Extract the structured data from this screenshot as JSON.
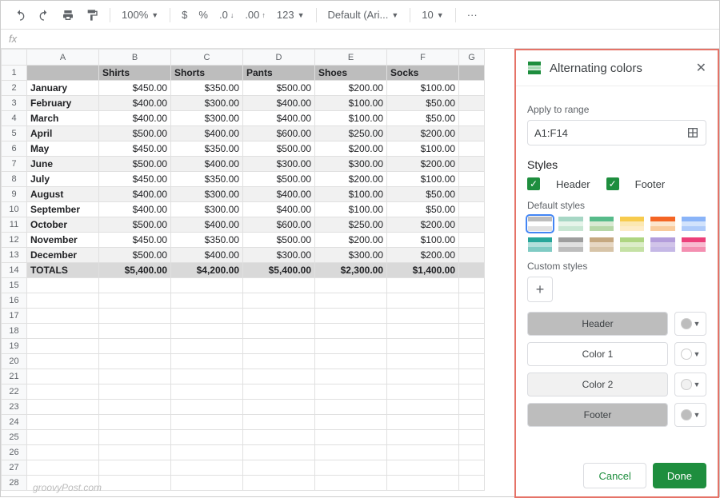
{
  "toolbar": {
    "zoom": "100%",
    "currency": "$",
    "percent": "%",
    "dec_dec": ".0",
    "dec_inc": ".00",
    "format123": "123",
    "font": "Default (Ari...",
    "font_size": "10",
    "more": "···"
  },
  "fx": "fx",
  "columns": [
    "A",
    "B",
    "C",
    "D",
    "E",
    "F",
    "G"
  ],
  "header_row": [
    "",
    "Shirts",
    "Shorts",
    "Pants",
    "Shoes",
    "Socks"
  ],
  "rows": [
    {
      "month": "January",
      "vals": [
        "$450.00",
        "$350.00",
        "$500.00",
        "$200.00",
        "$100.00"
      ]
    },
    {
      "month": "February",
      "vals": [
        "$400.00",
        "$300.00",
        "$400.00",
        "$100.00",
        "$50.00"
      ]
    },
    {
      "month": "March",
      "vals": [
        "$400.00",
        "$300.00",
        "$400.00",
        "$100.00",
        "$50.00"
      ]
    },
    {
      "month": "April",
      "vals": [
        "$500.00",
        "$400.00",
        "$600.00",
        "$250.00",
        "$200.00"
      ]
    },
    {
      "month": "May",
      "vals": [
        "$450.00",
        "$350.00",
        "$500.00",
        "$200.00",
        "$100.00"
      ]
    },
    {
      "month": "June",
      "vals": [
        "$500.00",
        "$400.00",
        "$300.00",
        "$300.00",
        "$200.00"
      ]
    },
    {
      "month": "July",
      "vals": [
        "$450.00",
        "$350.00",
        "$500.00",
        "$200.00",
        "$100.00"
      ]
    },
    {
      "month": "August",
      "vals": [
        "$400.00",
        "$300.00",
        "$400.00",
        "$100.00",
        "$50.00"
      ]
    },
    {
      "month": "September",
      "vals": [
        "$400.00",
        "$300.00",
        "$400.00",
        "$100.00",
        "$50.00"
      ]
    },
    {
      "month": "October",
      "vals": [
        "$500.00",
        "$400.00",
        "$600.00",
        "$250.00",
        "$200.00"
      ]
    },
    {
      "month": "November",
      "vals": [
        "$450.00",
        "$350.00",
        "$500.00",
        "$200.00",
        "$100.00"
      ]
    },
    {
      "month": "December",
      "vals": [
        "$500.00",
        "$400.00",
        "$300.00",
        "$300.00",
        "$200.00"
      ]
    }
  ],
  "totals": {
    "label": "TOTALS",
    "vals": [
      "$5,400.00",
      "$4,200.00",
      "$5,400.00",
      "$2,300.00",
      "$1,400.00"
    ]
  },
  "empty_rows": [
    15,
    16,
    17,
    18,
    19,
    20,
    21,
    22,
    23,
    24,
    25,
    26,
    27,
    28
  ],
  "watermark": "groovyPost.com",
  "panel": {
    "title": "Alternating colors",
    "apply_label": "Apply to range",
    "range": "A1:F14",
    "styles_label": "Styles",
    "header_chk": "Header",
    "footer_chk": "Footer",
    "default_label": "Default styles",
    "custom_label": "Custom styles",
    "style_rows": {
      "header": "Header",
      "color1": "Color 1",
      "color2": "Color 2",
      "footer": "Footer"
    },
    "style_colors": {
      "header": "#bdbdbd",
      "color1": "#ffffff",
      "color2": "#f1f1f1",
      "footer": "#bdbdbd"
    },
    "swatches": [
      {
        "top": "#bdbdbd",
        "mid": "#ffffff",
        "bot": "#e0e0e0",
        "selected": true
      },
      {
        "top": "#a7d7c5",
        "mid": "#e6f4ea",
        "bot": "#c8e6d3",
        "selected": false
      },
      {
        "top": "#57bb8a",
        "mid": "#d9ead3",
        "bot": "#b6d7a8",
        "selected": false
      },
      {
        "top": "#f7cb4d",
        "mid": "#fce8b2",
        "bot": "#fdecc8",
        "selected": false
      },
      {
        "top": "#f46524",
        "mid": "#fce5cd",
        "bot": "#f9cb9c",
        "selected": false
      },
      {
        "top": "#8ab4f8",
        "mid": "#d2e3fc",
        "bot": "#aecbfa",
        "selected": false
      },
      {
        "top": "#26a69a",
        "mid": "#b2dfdb",
        "bot": "#80cbc4",
        "selected": false
      },
      {
        "top": "#9e9e9e",
        "mid": "#e0e0e0",
        "bot": "#bdbdbd",
        "selected": false
      },
      {
        "top": "#c5a880",
        "mid": "#e6d7c3",
        "bot": "#d7c4a8",
        "selected": false
      },
      {
        "top": "#aed581",
        "mid": "#dcedc8",
        "bot": "#c5e1a5",
        "selected": false
      },
      {
        "top": "#b39ddb",
        "mid": "#d1c4e9",
        "bot": "#c5b8e6",
        "selected": false
      },
      {
        "top": "#ec407a",
        "mid": "#f8bbd0",
        "bot": "#f48fb1",
        "selected": false
      }
    ],
    "cancel": "Cancel",
    "done": "Done"
  }
}
